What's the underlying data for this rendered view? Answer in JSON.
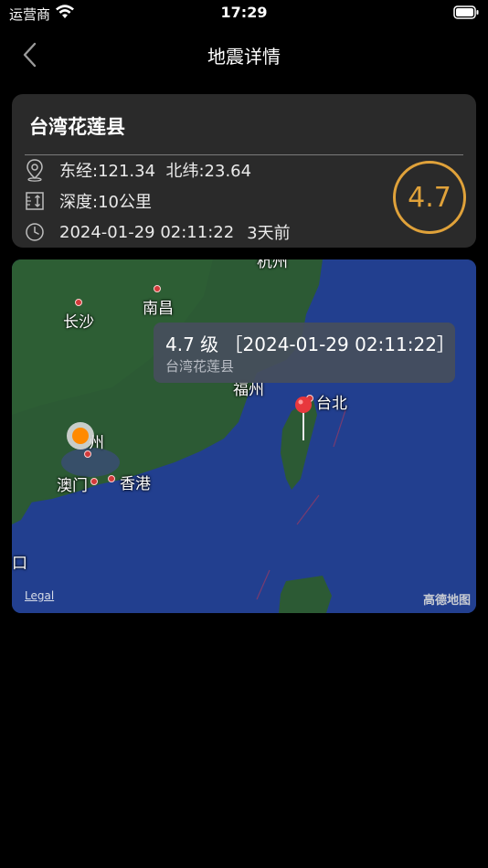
{
  "status": {
    "carrier": "运营商",
    "time": "17:29"
  },
  "nav": {
    "title": "地震详情"
  },
  "quake": {
    "place": "台湾花莲县",
    "coords": "东经:121.34  北纬:23.64",
    "depth": "深度:10公里",
    "datetime": "2024-01-29 02:11:22",
    "relative": "3天前",
    "magnitude": "4.7",
    "accent_color": "#e0a23a"
  },
  "map": {
    "cities": {
      "hangzhou": "杭州",
      "nanchang": "南昌",
      "changsha": "长沙",
      "fuzhou": "福州",
      "taipei": "台北",
      "guangzhou": "州",
      "macau": "澳门",
      "hongkong": "香港",
      "edge": "口"
    },
    "callout": {
      "title": "4.7 级 ［2024-01-29 02:11:22］",
      "subtitle": "台湾花莲县"
    },
    "legal": "Legal",
    "logo": "高德地图"
  }
}
